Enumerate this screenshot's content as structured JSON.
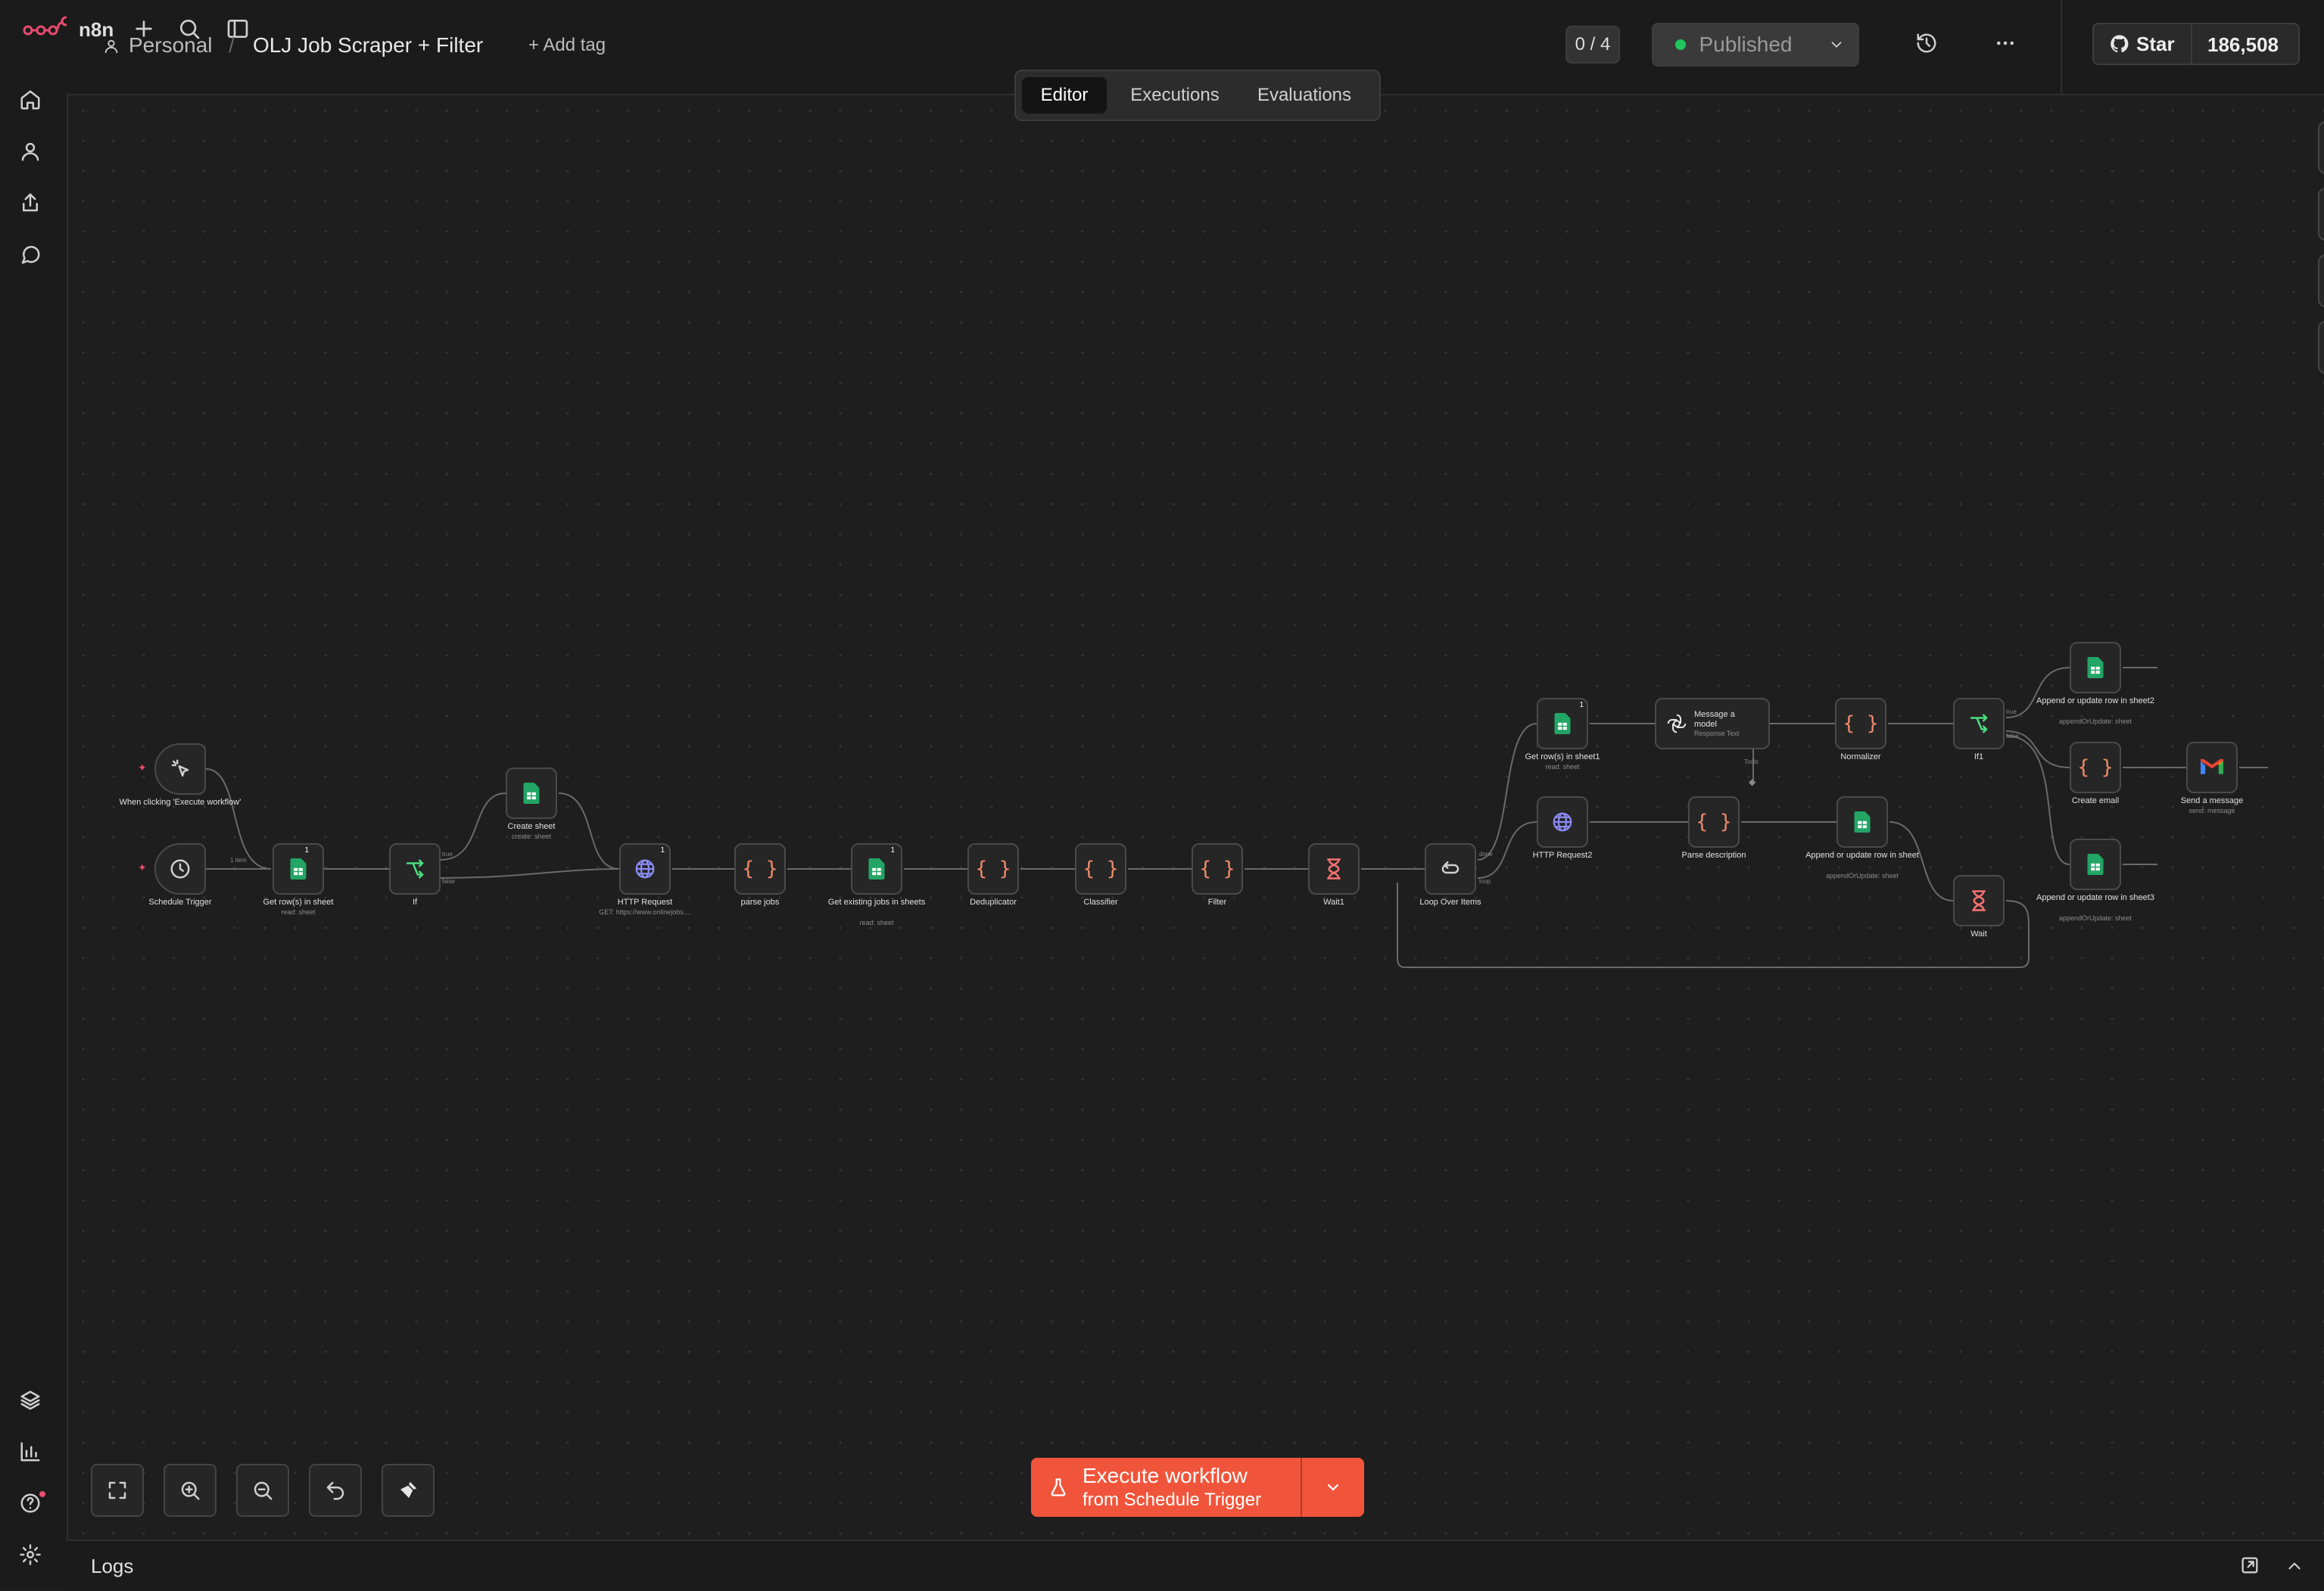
{
  "app": {
    "brand": "n8n",
    "accent_color": "#f0553b"
  },
  "header": {
    "project": "Personal",
    "separator": "/",
    "workflow_title": "OLJ Job Scraper + Filter",
    "add_tag": "+ Add tag",
    "counter": "0 / 4",
    "status": "Published",
    "status_color": "#22c55e",
    "github_star": "Star",
    "github_count": "186,508"
  },
  "tabs": [
    {
      "label": "Editor",
      "active": true
    },
    {
      "label": "Executions",
      "active": false
    },
    {
      "label": "Evaluations",
      "active": false
    }
  ],
  "sidebar": {
    "top_icons": [
      "home-icon",
      "user-icon",
      "share-icon",
      "chat-icon"
    ],
    "bottom_icons": [
      "templates-icon",
      "insights-icon",
      "help-icon",
      "settings-icon"
    ]
  },
  "canvas": {
    "nodes": [
      {
        "id": "manual",
        "label": "When clicking 'Execute workflow'",
        "sub": "",
        "icon": "pointer-icon",
        "trigger": true
      },
      {
        "id": "schedule",
        "label": "Schedule Trigger",
        "sub": "",
        "icon": "clock-icon",
        "trigger": true
      },
      {
        "id": "getrows",
        "label": "Get row(s) in sheet",
        "sub": "read: sheet",
        "icon": "sheets-icon",
        "badge": "1"
      },
      {
        "id": "if",
        "label": "If",
        "sub": "",
        "icon": "branch-icon"
      },
      {
        "id": "createsheet",
        "label": "Create sheet",
        "sub": "create: sheet",
        "icon": "sheets-icon"
      },
      {
        "id": "http",
        "label": "HTTP Request",
        "sub": "GET: https://www.onlinejobs....",
        "icon": "globe-icon",
        "badge": "1"
      },
      {
        "id": "parse",
        "label": "parse jobs",
        "sub": "",
        "icon": "code-icon"
      },
      {
        "id": "getexisting",
        "label": "Get existing jobs in sheets",
        "sub": "read: sheet",
        "icon": "sheets-icon",
        "badge": "1"
      },
      {
        "id": "dedup",
        "label": "Deduplicator",
        "sub": "",
        "icon": "code-icon"
      },
      {
        "id": "classifier",
        "label": "Classifier",
        "sub": "",
        "icon": "code-icon"
      },
      {
        "id": "filter",
        "label": "Filter",
        "sub": "",
        "icon": "code-icon"
      },
      {
        "id": "wait1",
        "label": "Wait1",
        "sub": "",
        "icon": "hourglass-icon"
      },
      {
        "id": "loop",
        "label": "Loop Over Items",
        "sub": "",
        "icon": "loop-icon"
      },
      {
        "id": "getrows1",
        "label": "Get row(s) in sheet1",
        "sub": "read: sheet",
        "icon": "sheets-icon",
        "badge": "1"
      },
      {
        "id": "http2",
        "label": "HTTP Request2",
        "sub": "",
        "icon": "globe-icon"
      },
      {
        "id": "message",
        "label": "Message a model",
        "sub": "Response Text",
        "icon": "openai-icon"
      },
      {
        "id": "parsedesc",
        "label": "Parse description",
        "sub": "",
        "icon": "code-icon"
      },
      {
        "id": "normalizer",
        "label": "Normalizer",
        "sub": "",
        "icon": "code-icon"
      },
      {
        "id": "append",
        "label": "Append or update row in sheet",
        "sub": "appendOrUpdate: sheet",
        "icon": "sheets-icon"
      },
      {
        "id": "if1",
        "label": "If1",
        "sub": "",
        "icon": "branch-icon"
      },
      {
        "id": "wait",
        "label": "Wait",
        "sub": "",
        "icon": "hourglass-icon"
      },
      {
        "id": "append2",
        "label": "Append or update row in sheet2",
        "sub": "appendOrUpdate: sheet",
        "icon": "sheets-icon"
      },
      {
        "id": "createemail",
        "label": "Create email",
        "sub": "",
        "icon": "code-icon"
      },
      {
        "id": "append3",
        "label": "Append or update row in sheet3",
        "sub": "appendOrUpdate: sheet",
        "icon": "sheets-icon"
      },
      {
        "id": "send",
        "label": "Send a message",
        "sub": "send: message",
        "icon": "gmail-icon"
      }
    ],
    "edge_labels": {
      "items": "1 item",
      "true": "true",
      "false": "false",
      "done": "done",
      "loop": "loop",
      "tools": "Tools"
    }
  },
  "execute": {
    "title": "Execute workflow",
    "subtitle": "from Schedule Trigger"
  },
  "logs": {
    "label": "Logs"
  }
}
